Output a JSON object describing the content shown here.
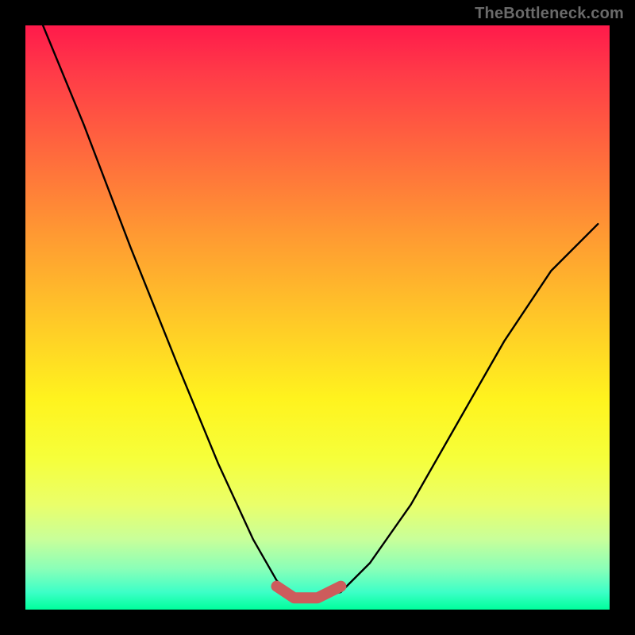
{
  "watermark": "TheBottleneck.com",
  "chart_data": {
    "type": "line",
    "title": "",
    "xlabel": "",
    "ylabel": "",
    "xlim": [
      0,
      1
    ],
    "ylim": [
      0,
      1
    ],
    "series": [
      {
        "name": "bottleneck-curve",
        "x": [
          0.03,
          0.1,
          0.18,
          0.26,
          0.33,
          0.39,
          0.43,
          0.46,
          0.5,
          0.54,
          0.59,
          0.66,
          0.74,
          0.82,
          0.9,
          0.98
        ],
        "y": [
          1.0,
          0.83,
          0.62,
          0.42,
          0.25,
          0.12,
          0.05,
          0.02,
          0.02,
          0.03,
          0.08,
          0.18,
          0.32,
          0.46,
          0.58,
          0.66
        ],
        "stroke": "#000000"
      },
      {
        "name": "optimal-band",
        "x": [
          0.43,
          0.46,
          0.5,
          0.54
        ],
        "y": [
          0.04,
          0.02,
          0.02,
          0.04
        ],
        "stroke": "#cd5c5c"
      }
    ],
    "gradient_stops": [
      {
        "pos": 0.0,
        "color": "#ff1a4b"
      },
      {
        "pos": 0.5,
        "color": "#ffc728"
      },
      {
        "pos": 0.74,
        "color": "#eaff6a"
      },
      {
        "pos": 1.0,
        "color": "#00ff9c"
      }
    ]
  }
}
